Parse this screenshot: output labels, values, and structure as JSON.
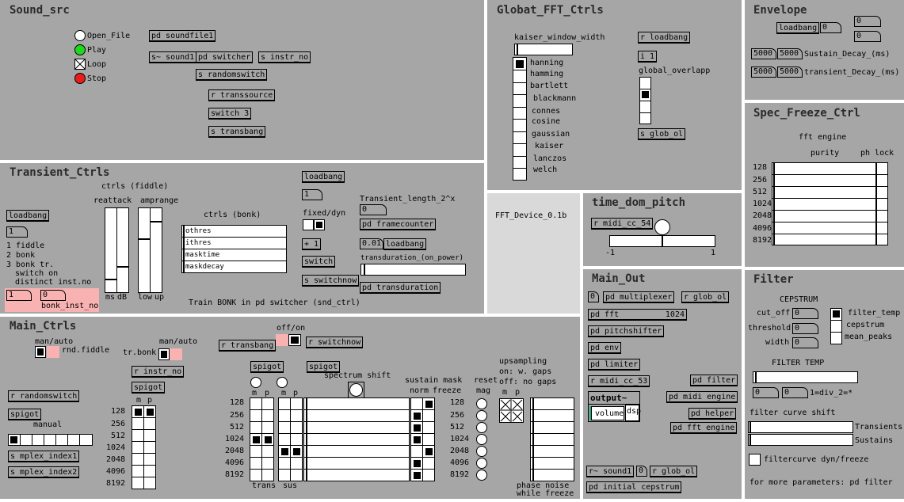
{
  "panels": {
    "sound_src": "Sound_src",
    "global_fft": "Globat_FFT_Ctrls",
    "envelope": "Envelope",
    "spec_freeze": "Spec_Freeze_Ctrl",
    "transient": "Transient_Ctrls",
    "device": "FFT_Device_0.1b",
    "time_dom": "time_dom_pitch",
    "main_out": "Main_Out",
    "filter": "Filter",
    "main_ctrls": "Main_Ctrls"
  },
  "sound": {
    "open": "Open_File",
    "play": "Play",
    "loop": "Loop",
    "stop": "Stop",
    "soundfile": "pd soundfile1",
    "s_sound": "s~ sound1",
    "switcher": "pd switcher",
    "instr": "s instr_no",
    "randomswitch": "s randomswitch",
    "transsource": "r transsource",
    "switch3": "switch 3",
    "transbang": "s transbang"
  },
  "fft": {
    "kaiser": "kaiser_window_width",
    "windows": [
      "hanning",
      "hamming",
      "bartlett",
      "blackmann",
      "connes",
      "cosine",
      "gaussian",
      "kaiser",
      "lanczos",
      "welch"
    ],
    "loadbang": "r loadbang",
    "i1": "i 1",
    "overlap": "global_overlapp",
    "glob_ol": "s glob_ol"
  },
  "env": {
    "loadbang": "loadbang",
    "n0": "0",
    "n1": "0",
    "n2": "0",
    "s1": "5000",
    "s2": "5000",
    "sus_label": "Sustain_Decay_(ms)",
    "t1": "5000",
    "t2": "5000",
    "trans_label": "transient_Decay_(ms)"
  },
  "spec": {
    "engine": "fft engine",
    "purity": "purity",
    "phlock": "ph lock",
    "rows": [
      "128",
      "256",
      "512",
      "1024",
      "2048",
      "4096",
      "8192"
    ]
  },
  "trans": {
    "fiddle": "ctrls (fiddle)",
    "reattack": "reattack",
    "amprange": "amprange",
    "ms": "ms",
    "db": "dB",
    "low": "low",
    "up": "up",
    "bonk": "ctrls (bonk)",
    "bonk_rows": [
      "othres",
      "ithres",
      "masktime",
      "maskdecay"
    ],
    "loadbang": "loadbang",
    "n1": "1",
    "opt1": "1 fiddle",
    "opt2": "2 bonk",
    "opt3": "3 bonk tr.",
    "opt3b": "switch on",
    "opt3c": "distinct inst.no",
    "n_one": "1",
    "n_zero": "0",
    "bonk_inst": "bonk_inst_no",
    "loadbang2": "loadbang",
    "n2": "1",
    "fixed": "fixed/dyn",
    "plus1": "+ 1",
    "switch": "switch",
    "switchnow": "s switchnow",
    "tlen": "Transient_length_2^x",
    "tlen_val": "0",
    "framecounter": "pd framecounter",
    "v001": "0.01",
    "loadbang3": "loadbang",
    "transdur": "transduration_(on_power)",
    "pdtransdur": "pd transduration",
    "train": "Train BONK in pd switcher (snd_ctrl)"
  },
  "device": {
    "label": "FFT_Device_0.1b"
  },
  "tdp": {
    "midi": "r midi_cc_54",
    "m1": "-1",
    "p1": "1"
  },
  "mout": {
    "n0": "0",
    "mplex": "pd multiplexer",
    "globol": "r glob_ol",
    "fft": "pd fft",
    "fftn": "1024",
    "pitch": "pd pitchshifter",
    "env": "pd env",
    "limiter": "pd limiter",
    "midi53": "r midi_cc_53",
    "output": "output~",
    "volume": "volume",
    "dsp": "dsp",
    "filter": "pd filter",
    "midiengine": "pd midi engine",
    "helper": "pd helper",
    "fftengine": "pd fft engine",
    "sound": "r~ sound1",
    "n2": "0",
    "globol2": "r glob_ol",
    "initcep": "pd initial cepstrum"
  },
  "filter": {
    "cep": "CEPSTRUM",
    "cutoff": "cut_off",
    "cv": "0",
    "threshold": "threshold",
    "tv": "0",
    "width": "width",
    "wv": "0",
    "ftemp": "filter_temp",
    "cepstrum": "cepstrum",
    "meanpeaks": "mean_peaks",
    "ftemp_title": "FILTER TEMP",
    "n1": "0",
    "n2": "0",
    "div": "1=div_2=*",
    "shift": "filter curve shift",
    "transients": "Transients",
    "sustains": "Sustains",
    "dynfreeze": "filtercurve dyn/freeze",
    "more": "for more parameters: pd filter"
  },
  "mc": {
    "manauto": "man/auto",
    "rnd": "rnd.fiddle",
    "trbonk": "tr.bonk",
    "manauto2": "man/auto",
    "offon": "off/on",
    "rtransbang": "r transbang",
    "rswitchnow": "r switchnow",
    "rinstr": "r instr_no",
    "spigot1": "spigot",
    "rrandom": "r randomswitch",
    "spigot2": "spigot",
    "manual": "manual",
    "mplex1": "s mplex_index1",
    "mplex2": "s mplex_index2",
    "m": "m",
    "p": "p",
    "rows": [
      "128",
      "256",
      "512",
      "1024",
      "2048",
      "4096",
      "8192"
    ],
    "spigot3": "spigot",
    "spigot4": "spigot",
    "specshift": "spectrum shift",
    "susmask": "sustain mask",
    "norm": "norm",
    "freeze": "freeze",
    "reset": "reset",
    "mag": "mag",
    "ups": "upsampling",
    "on": "on: w. gaps",
    "off": "off: no gaps",
    "trans": "trans",
    "sus": "sus",
    "phase": "phase noise",
    "while": "while freeze"
  }
}
